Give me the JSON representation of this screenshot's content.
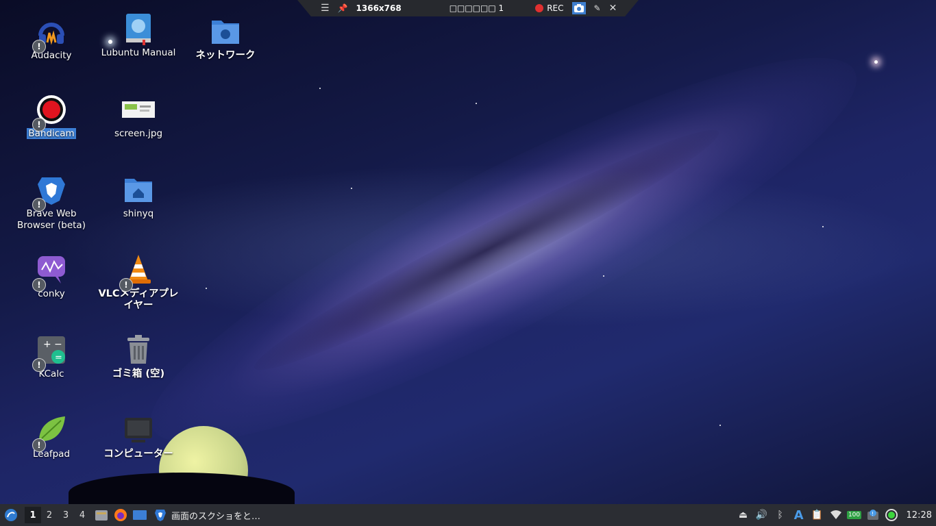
{
  "capture_bar": {
    "resolution": "1366x768",
    "mode_label": "□□□□□□ 1",
    "rec_label": "REC"
  },
  "desktop_icons": [
    {
      "label": "Audacity",
      "icon": "audacity-icon"
    },
    {
      "label": "Lubuntu Manual",
      "icon": "manual-icon"
    },
    {
      "label": "ネットワーク",
      "icon": "network-folder-icon"
    },
    {
      "label": "Bandicam",
      "icon": "bandicam-icon"
    },
    {
      "label": "screen.jpg",
      "icon": "image-file-icon"
    },
    {
      "label": "Brave Web Browser (beta)",
      "icon": "brave-icon"
    },
    {
      "label": "shinyq",
      "icon": "home-folder-icon"
    },
    {
      "label": "conky",
      "icon": "conky-icon"
    },
    {
      "label": "VLCメディアプレイヤー",
      "icon": "vlc-icon"
    },
    {
      "label": "KCalc",
      "icon": "calculator-icon"
    },
    {
      "label": "ゴミ箱 (空)",
      "icon": "trash-icon"
    },
    {
      "label": "Leafpad",
      "icon": "leafpad-icon"
    },
    {
      "label": "コンピューター",
      "icon": "computer-icon"
    }
  ],
  "taskbar": {
    "workspaces": [
      "1",
      "2",
      "3",
      "4"
    ],
    "active_workspace": "1",
    "task_title": "画面のスクショをと…",
    "clock": "12:28",
    "battery": "100"
  }
}
